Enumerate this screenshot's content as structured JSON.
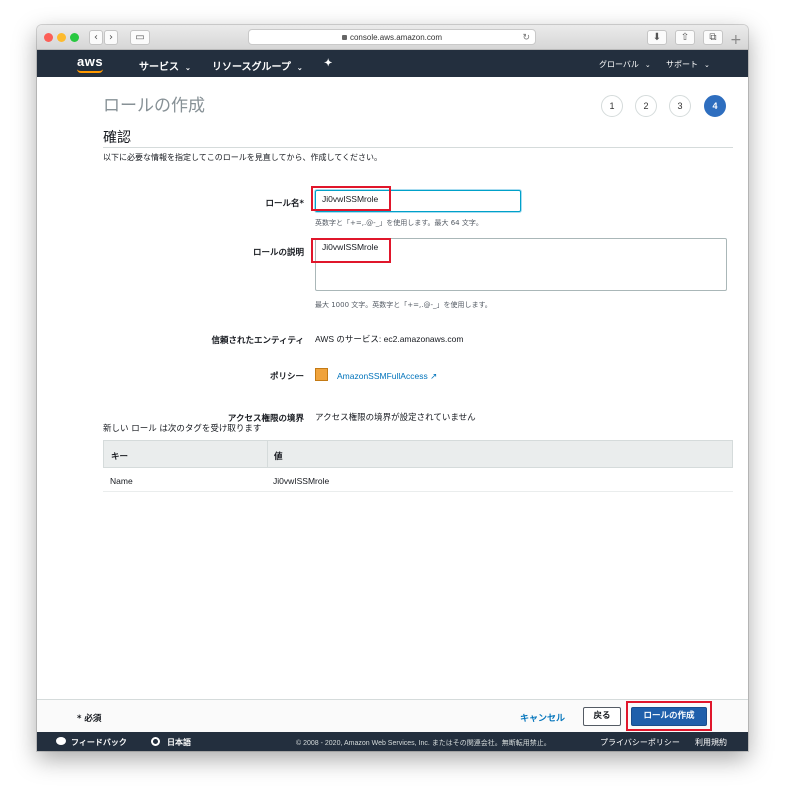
{
  "browser": {
    "url": "console.aws.amazon.com",
    "back_glyph": "‹",
    "forward_glyph": "›",
    "sidebar_glyph": "▭",
    "download_glyph": "⬇",
    "share_glyph": "⇧",
    "tabs_glyph": "⧉",
    "reload_glyph": "↻",
    "newtab_glyph": "+"
  },
  "nav": {
    "logo": "aws",
    "services": "サービス",
    "resource_groups": "リソースグループ",
    "pin_glyph": "✦",
    "region": "グローバル",
    "support": "サポート",
    "caret": "⌄"
  },
  "page": {
    "title": "ロールの作成",
    "steps": [
      "1",
      "2",
      "3",
      "4"
    ],
    "active_step": "4",
    "section_title": "確認",
    "intro": "以下に必要な情報を指定してこのロールを見直してから、作成してください。"
  },
  "form": {
    "role_name_label": "ロール名*",
    "role_name_value": "Ji0vwISSMrole",
    "role_name_hint": "英数字と「+=,.@-_」を使用します。最大 64 文字。",
    "role_desc_label": "ロールの説明",
    "role_desc_value": "Ji0vwISSMrole",
    "role_desc_hint": "最大 1000 文字。英数字と「+=,.@-_」を使用します。",
    "trusted_label": "信頼されたエンティティ",
    "trusted_value": "AWS のサービス: ec2.amazonaws.com",
    "policy_label": "ポリシー",
    "policy_value": "AmazonSSMFullAccess",
    "external_glyph": "↗",
    "boundary_label": "アクセス権限の境界",
    "boundary_value": "アクセス権限の境界が設定されていません"
  },
  "tags": {
    "title": "新しい ロール は次のタグを受け取ります",
    "columns": [
      "キー",
      "値"
    ],
    "rows": [
      {
        "key": "Name",
        "value": "Ji0vwISSMrole"
      }
    ]
  },
  "footer": {
    "required": "* 必須",
    "cancel": "キャンセル",
    "back": "戻る",
    "create": "ロールの作成"
  },
  "bottombar": {
    "feedback": "フィードバック",
    "language": "日本語",
    "copyright": "© 2008 - 2020, Amazon Web Services, Inc. またはその関連会社。無断転用禁止。",
    "privacy": "プライバシーポリシー",
    "terms": "利用規約"
  },
  "colors": {
    "nav_bg": "#232f3e",
    "accent_orange": "#ff9900",
    "primary_button": "#1f5fab",
    "link": "#0073bb",
    "annotation_red": "#e0162b"
  }
}
